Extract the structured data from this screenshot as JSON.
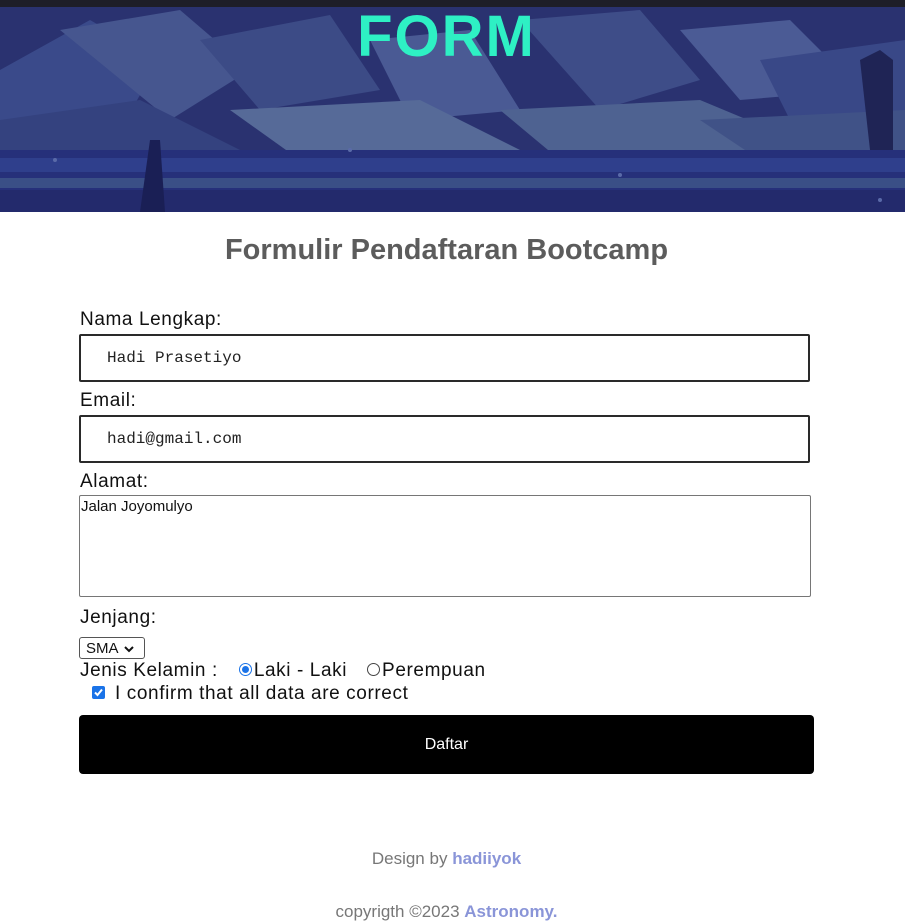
{
  "hero": {
    "title": "FORM",
    "title_color": "#2ef0c4"
  },
  "form": {
    "title": "Formulir Pendaftaran Bootcamp",
    "name_label": "Nama Lengkap:",
    "name_value": "Hadi Prasetiyo",
    "email_label": "Email:",
    "email_value": "hadi@gmail.com",
    "address_label": "Alamat:",
    "address_value": "Jalan Joyomulyo",
    "level_label": "Jenjang:",
    "level_selected": "SMA",
    "gender_label": "Jenis Kelamin :",
    "gender_options": [
      {
        "label": "Laki - Laki",
        "checked": true
      },
      {
        "label": "Perempuan",
        "checked": false
      }
    ],
    "confirm_label": "I confirm that all data are correct",
    "confirm_checked": true,
    "submit_label": "Daftar"
  },
  "footer": {
    "design_prefix": "Design by",
    "design_author": "hadiiyok",
    "copyright_prefix": "copyrigth ©2023",
    "copyright_brand": "Astronomy."
  }
}
